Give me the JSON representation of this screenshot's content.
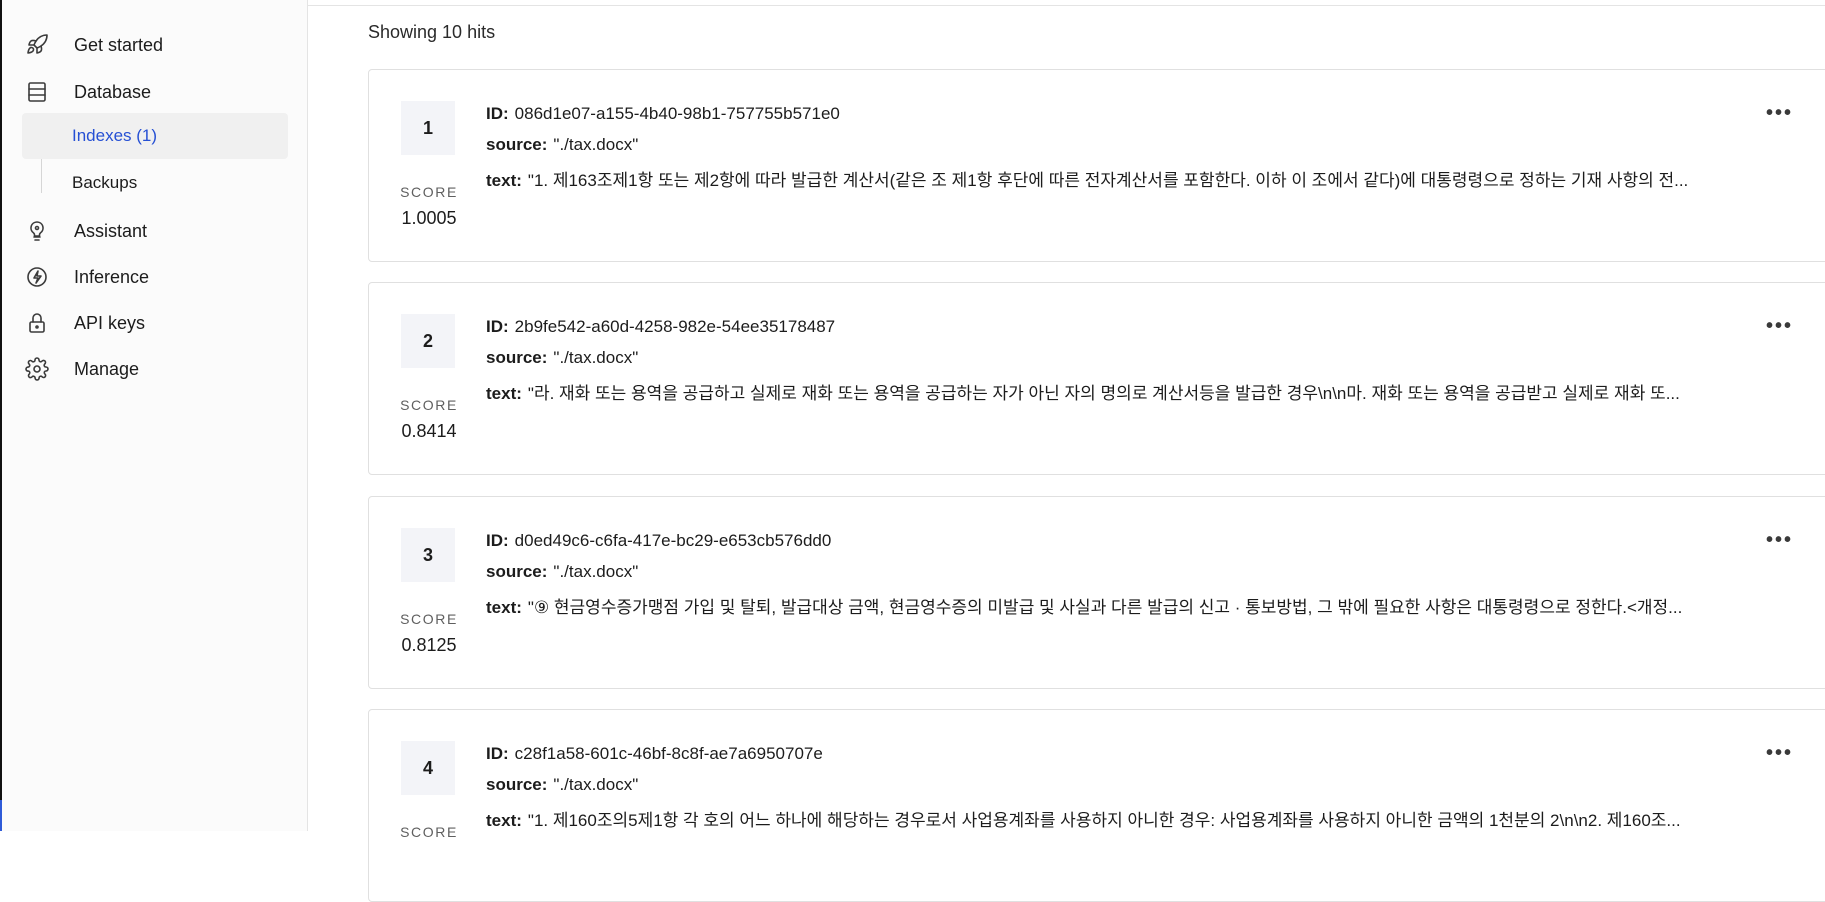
{
  "sidebar": {
    "items": [
      {
        "label": "Get started",
        "icon": "rocket-icon"
      },
      {
        "label": "Database",
        "icon": "database-icon"
      },
      {
        "label": "Assistant",
        "icon": "lightbulb-icon"
      },
      {
        "label": "Inference",
        "icon": "bolt-icon"
      },
      {
        "label": "API keys",
        "icon": "lock-icon"
      },
      {
        "label": "Manage",
        "icon": "gear-icon"
      }
    ],
    "sub_items": [
      {
        "label": "Indexes (1)",
        "active": true
      },
      {
        "label": "Backups",
        "active": false
      }
    ],
    "accent_color": "#2650d4"
  },
  "results": {
    "hits_label": "Showing 10 hits",
    "score_label": "SCORE",
    "id_label": "ID:",
    "source_label": "source:",
    "text_label": "text:",
    "more_label": "•••",
    "hits": [
      {
        "rank": "1",
        "score": "1.0005",
        "id": "086d1e07-a155-4b40-98b1-757755b571e0",
        "source": "\"./tax.docx\"",
        "text": "\"1. 제163조제1항 또는 제2항에 따라 발급한 계산서(같은 조 제1항 후단에 따른 전자계산서를 포함한다. 이하 이 조에서 같다)에 대통령령으로 정하는 기재 사항의 전..."
      },
      {
        "rank": "2",
        "score": "0.8414",
        "id": "2b9fe542-a60d-4258-982e-54ee35178487",
        "source": "\"./tax.docx\"",
        "text": "\"라. 재화 또는 용역을 공급하고 실제로 재화 또는 용역을 공급하는 자가 아닌 자의 명의로 계산서등을 발급한 경우\\n\\n마. 재화 또는 용역을 공급받고 실제로 재화 또..."
      },
      {
        "rank": "3",
        "score": "0.8125",
        "id": "d0ed49c6-c6fa-417e-bc29-e653cb576dd0",
        "source": "\"./tax.docx\"",
        "text": "\"⑨ 현금영수증가맹점 가입 및 탈퇴, 발급대상 금액, 현금영수증의 미발급 및 사실과 다른 발급의 신고 · 통보방법, 그 밖에 필요한 사항은 대통령령으로 정한다.<개정..."
      },
      {
        "rank": "4",
        "score": "",
        "id": "c28f1a58-601c-46bf-8c8f-ae7a6950707e",
        "source": "\"./tax.docx\"",
        "text": "\"1. 제160조의5제1항 각 호의 어느 하나에 해당하는 경우로서 사업용계좌를 사용하지 아니한 경우: 사업용계좌를 사용하지 아니한 금액의 1천분의 2\\n\\n2. 제160조..."
      }
    ]
  }
}
